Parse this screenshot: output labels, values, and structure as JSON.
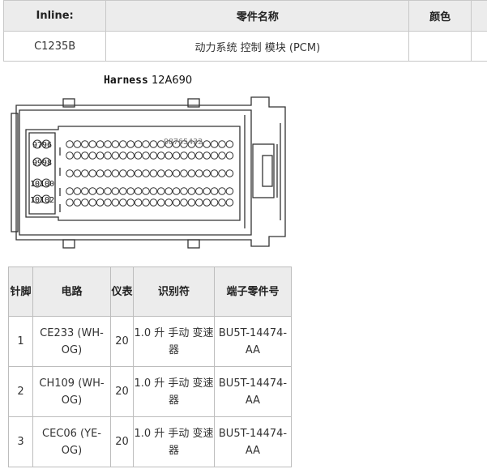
{
  "info_table": {
    "headers": [
      "Inline:",
      "零件名称",
      "颜色"
    ],
    "row": {
      "inline": "C1235B",
      "part_name": "动力系统 控制 模块 (PCM)",
      "color": ""
    }
  },
  "harness": {
    "prefix": "Harness",
    "code": "12A690"
  },
  "connector": {
    "row_labels": [
      "9796",
      "9998",
      "10100",
      "10102"
    ],
    "top_digits": "98765432"
  },
  "pin_table": {
    "headers": [
      "针脚",
      "电路",
      "仪表",
      "识别符",
      "端子零件号"
    ],
    "rows": [
      {
        "pin": "1",
        "circuit": "CE233 (WH-OG)",
        "gauge": "20",
        "identifier": "1.0 升 手动 变速器",
        "terminal": "BU5T-14474-AA"
      },
      {
        "pin": "2",
        "circuit": "CH109 (WH-OG)",
        "gauge": "20",
        "identifier": "1.0 升 手动 变速器",
        "terminal": "BU5T-14474-AA"
      },
      {
        "pin": "3",
        "circuit": "CEC06 (YE-OG)",
        "gauge": "20",
        "identifier": "1.0 升 手动 变速器",
        "terminal": "BU5T-14474-AA"
      }
    ]
  }
}
